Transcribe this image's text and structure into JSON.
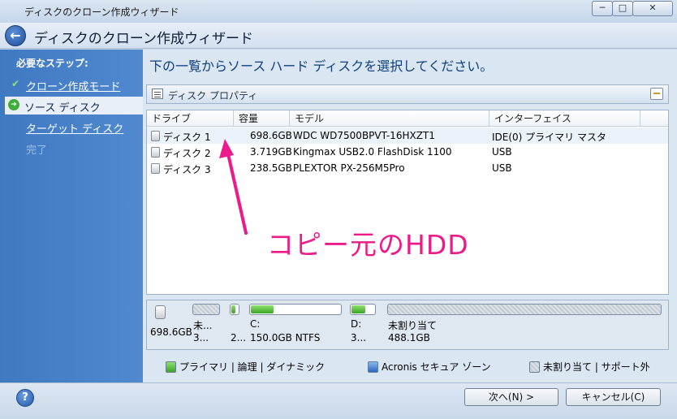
{
  "window": {
    "title": "ディスクのクローン作成ウィザード",
    "minimize": "─",
    "maximize": "□",
    "close": "✕"
  },
  "header": {
    "title": "ディスクのクローン作成ウィザード"
  },
  "steps": {
    "title": "必要なステップ:",
    "items": [
      {
        "label": "クローン作成モード",
        "state": "done"
      },
      {
        "label": "ソース ディスク",
        "state": "current"
      },
      {
        "label": "ターゲット ディスク",
        "state": "next"
      },
      {
        "label": "完了",
        "state": "disabled"
      }
    ]
  },
  "main": {
    "instruction": "下の一覧からソース ハード ディスクを選択してください。",
    "properties_title": "ディスク プロパティ",
    "columns": [
      "ドライブ",
      "容量",
      "モデル",
      "インターフェイス"
    ],
    "rows": [
      {
        "drive": "ディスク 1",
        "capacity": "698.6GB",
        "model": "WDC WD7500BPVT-16HXZT1",
        "interface": "IDE(0) プライマリ マスタ"
      },
      {
        "drive": "ディスク 2",
        "capacity": "3.719GB",
        "model": "Kingmax USB2.0 FlashDisk 1100",
        "interface": "USB"
      },
      {
        "drive": "ディスク 3",
        "capacity": "238.5GB",
        "model": "PLEXTOR PX-256M5Pro",
        "interface": "USB"
      }
    ],
    "annotation": "コピー元のHDD"
  },
  "diskmap": {
    "disk_size": "698.6GB",
    "partitions": [
      {
        "line1": "未...",
        "line2": "3...",
        "type": "gray"
      },
      {
        "line1": "",
        "line2": "2...",
        "type": "green",
        "fill": 0.45
      },
      {
        "line1": "C:",
        "line2": "150.0GB  NTFS",
        "type": "green",
        "fill": 0.25
      },
      {
        "line1": "D:",
        "line2": "3...",
        "type": "green",
        "fill": 0.55
      },
      {
        "line1": "未割り当て",
        "line2": "488.1GB",
        "type": "gray"
      }
    ]
  },
  "legend": {
    "primary": "プライマリ | 論理 | ダイナミック",
    "secure_zone": "Acronis セキュア ゾーン",
    "unallocated": "未割り当て | サポート外"
  },
  "footer": {
    "help": "?",
    "next": "次へ(N) >",
    "cancel": "キャンセル(C)"
  },
  "colors": {
    "accent": "#ec1a8a",
    "left_pane": "#4680c8",
    "instruction_text": "#0d3f80"
  }
}
